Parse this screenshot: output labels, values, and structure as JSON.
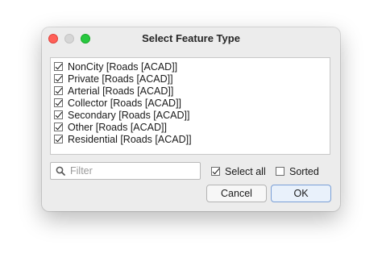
{
  "window": {
    "title": "Select Feature Type"
  },
  "feature_list": {
    "items": [
      {
        "label": "NonCity [Roads [ACAD]]",
        "checked": true
      },
      {
        "label": "Private [Roads [ACAD]]",
        "checked": true
      },
      {
        "label": "Arterial [Roads [ACAD]]",
        "checked": true
      },
      {
        "label": "Collector [Roads [ACAD]]",
        "checked": true
      },
      {
        "label": "Secondary [Roads [ACAD]]",
        "checked": true
      },
      {
        "label": "Other [Roads [ACAD]]",
        "checked": true
      },
      {
        "label": "Residential [Roads [ACAD]]",
        "checked": true
      }
    ]
  },
  "filter": {
    "placeholder": "Filter",
    "value": "",
    "icon": "search-icon"
  },
  "options": {
    "select_all_label": "Select all",
    "select_all_checked": true,
    "sorted_label": "Sorted",
    "sorted_checked": false
  },
  "buttons": {
    "cancel_label": "Cancel",
    "ok_label": "OK"
  },
  "colors": {
    "close": "#ff5f57",
    "minimize": "#d6d6d6",
    "maximize": "#28c840",
    "default_button_border": "#7a9fd6"
  }
}
